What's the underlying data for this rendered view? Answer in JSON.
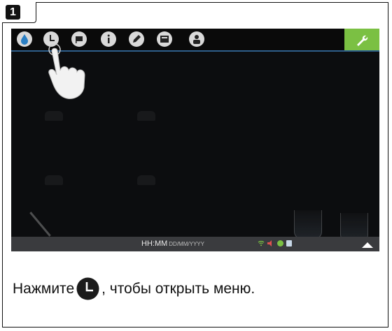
{
  "step": {
    "number": "1"
  },
  "screen": {
    "status_time": "HH:MM",
    "status_date": "DD/MM/YYYY",
    "toolbar_icons": [
      "drop-icon",
      "clock-icon",
      "flag-icon",
      "info-icon",
      "pencil-icon",
      "display-icon",
      "user-icon"
    ],
    "settings_icon": "wrench-icon",
    "colors": {
      "accent_green": "#7bc043",
      "toolbar_line": "#2f5f8c",
      "screen_bg": "#0c0d0f"
    }
  },
  "caption": {
    "before": "Нажмите",
    "after": ", чтобы открыть меню.",
    "icon": "clock-icon"
  }
}
